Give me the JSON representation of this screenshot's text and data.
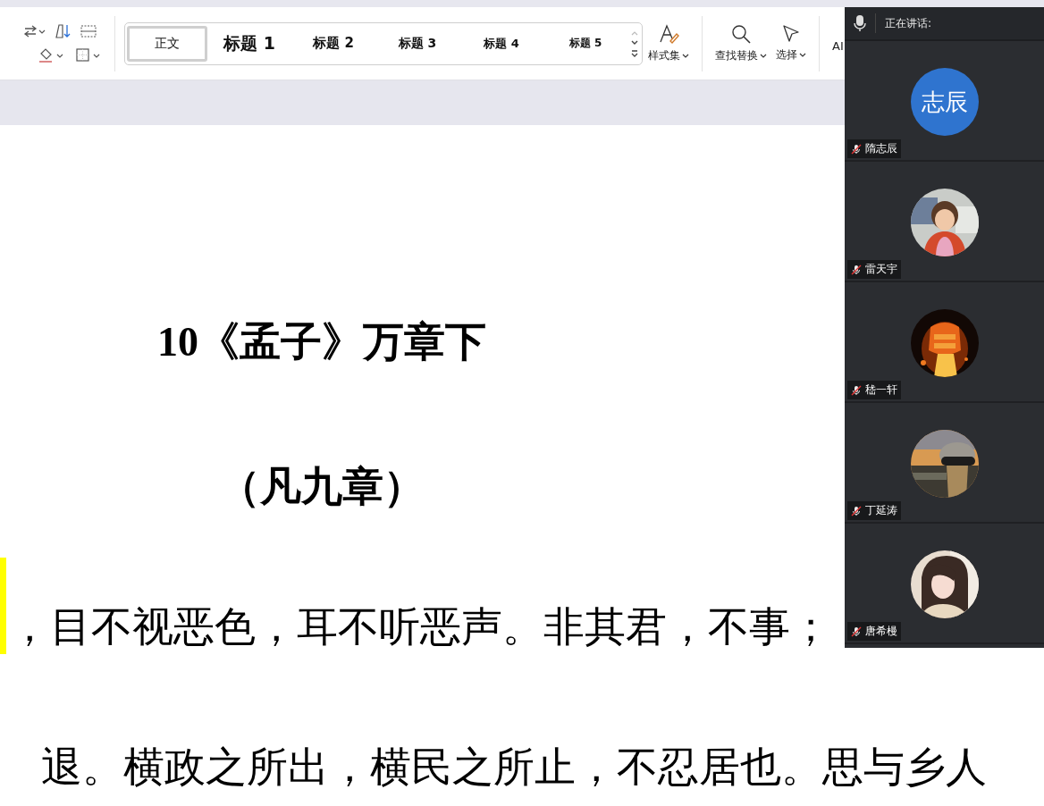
{
  "ribbon": {
    "styles": [
      {
        "label": "正文",
        "selected": true
      },
      {
        "label": "标题 1",
        "selected": false
      },
      {
        "label": "标题 2",
        "selected": false
      },
      {
        "label": "标题 3",
        "selected": false
      },
      {
        "label": "标题 4",
        "selected": false
      },
      {
        "label": "标题 5",
        "selected": false
      }
    ],
    "tools": [
      {
        "label": "样式集",
        "kind": "brush"
      },
      {
        "label": "查找替换",
        "kind": "search"
      },
      {
        "label": "选择",
        "kind": "pointer"
      },
      {
        "label": "AI",
        "kind": "text"
      }
    ]
  },
  "document": {
    "title": "10《孟子》万章下",
    "subtitle": "（凡九章）",
    "lines": [
      {
        "text": "，目不视恶色，耳不听恶声。非其君，不事；",
        "highlight": true
      },
      {
        "text": "退。横政之所出，横民之所止，不忍居也。思与乡人",
        "highlight": false
      }
    ]
  },
  "meeting": {
    "header": "正在讲话:",
    "participants": [
      {
        "name": "隋志辰",
        "muted": true,
        "avatar": {
          "kind": "initials",
          "text": "志辰"
        }
      },
      {
        "name": "雷天宇",
        "muted": true
      },
      {
        "name": "嵇一轩",
        "muted": true
      },
      {
        "name": "丁延涛",
        "muted": true
      },
      {
        "name": "唐希槾",
        "muted": true
      }
    ]
  }
}
